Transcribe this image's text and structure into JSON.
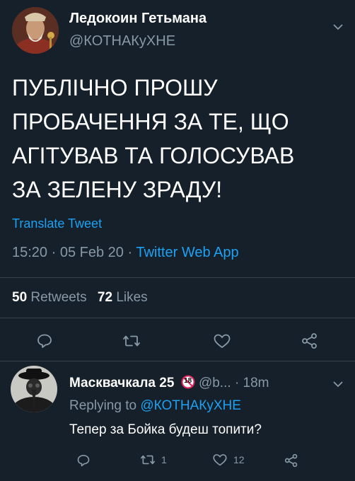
{
  "tweet": {
    "author_name": "Ледокоин Гетьмана",
    "author_handle": "@КОТНАКуХНЕ",
    "text_lines": [
      "ПУБЛІЧНО ПРОШУ",
      "ПРОБАЧЕННЯ ЗА ТЕ, ЩО",
      "АГІТУВАВ ТА ГОЛОСУВАВ",
      "ЗА ЗЕЛЕНУ ЗРАДУ!"
    ],
    "translate_label": "Translate Tweet",
    "time": "15:20",
    "date": "05 Feb 20",
    "sep": "·",
    "source": "Twitter Web App",
    "retweets_count": "50",
    "retweets_label": "Retweets",
    "likes_count": "72",
    "likes_label": "Likes"
  },
  "reply": {
    "author_name": "Масквачкала 25",
    "badge": "18",
    "handle": "@b...",
    "sep": "·",
    "time": "18m",
    "replying_prefix": "Replying to",
    "replying_handle": "@КОТНАКуХНЕ",
    "text": "Тепер за Бойка будеш топити?",
    "retweet_count": "1",
    "like_count": "12"
  },
  "icons": {
    "reply": "comment-icon",
    "retweet": "retweet-icon",
    "like": "heart-icon",
    "share": "share-icon",
    "menu": "chevron-down-icon"
  },
  "colors": {
    "background": "#15202b",
    "text": "#ffffff",
    "muted": "#8899a6",
    "accent": "#1da1f2",
    "badge": "#e0245e"
  }
}
